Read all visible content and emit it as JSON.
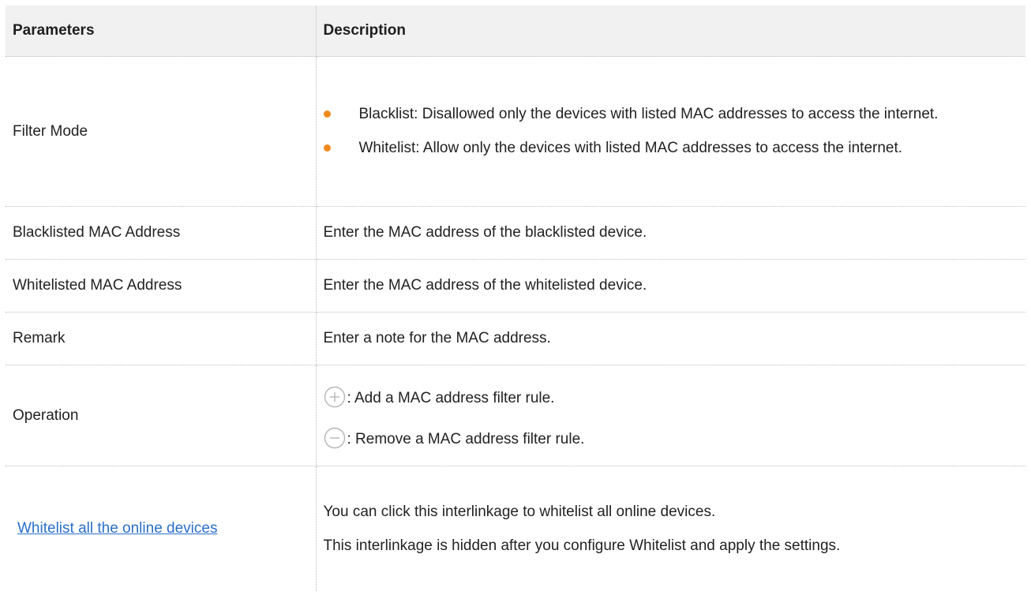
{
  "table": {
    "headers": {
      "parameters": "Parameters",
      "description": "Description"
    },
    "filter_mode": {
      "parameter": "Filter Mode",
      "bullets": [
        "Blacklist: Disallowed only the devices with listed MAC addresses to access the internet.",
        "Whitelist: Allow only the devices with listed MAC addresses to access the internet."
      ]
    },
    "blacklisted": {
      "parameter": "Blacklisted MAC Address",
      "description": "Enter the MAC address of the blacklisted device."
    },
    "whitelisted": {
      "parameter": "Whitelisted MAC Address",
      "description": "Enter the MAC address of the whitelisted device."
    },
    "remark": {
      "parameter": "Remark",
      "description": "Enter a note for the MAC address."
    },
    "operation": {
      "parameter": "Operation",
      "add_text": ": Add a MAC address filter rule.",
      "remove_text": ": Remove a MAC address filter rule."
    },
    "online_link": {
      "parameter": "Whitelist all the online devices",
      "descriptions": [
        "You can click this interlinkage to whitelist all online devices.",
        "This interlinkage is hidden after you configure Whitelist and apply the settings."
      ]
    }
  },
  "colors": {
    "bullet": "#f08a1d",
    "link": "#2a6fc9",
    "header_bg": "#f1f1f1",
    "border": "#bdbdbd",
    "icon_stroke": "#b5b5b5"
  },
  "icons": {
    "add": "plus-circle-icon",
    "remove": "minus-circle-icon"
  }
}
